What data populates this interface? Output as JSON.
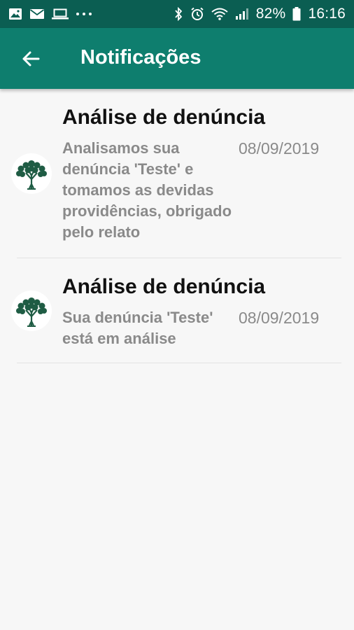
{
  "status_bar": {
    "left_icons": [
      "image-icon",
      "email-icon",
      "laptop-icon",
      "more-dots-icon"
    ],
    "right_icons": [
      "bluetooth-icon",
      "alarm-icon",
      "wifi-icon",
      "signal-icon",
      "battery-icon"
    ],
    "battery": "82%",
    "time": "16:16"
  },
  "app_bar": {
    "back_icon": "arrow-left-icon",
    "title": "Notificações",
    "color": "#0e7e6e"
  },
  "notifications": [
    {
      "icon": "tree-icon",
      "title": "Análise de denúncia",
      "body": "Analisamos sua denúncia 'Teste' e tomamos as devidas providências, obrigado pelo relato",
      "date": "08/09/2019"
    },
    {
      "icon": "tree-icon",
      "title": "Análise de denúncia",
      "body": "Sua denúncia 'Teste' está em análise",
      "date": "08/09/2019"
    }
  ]
}
